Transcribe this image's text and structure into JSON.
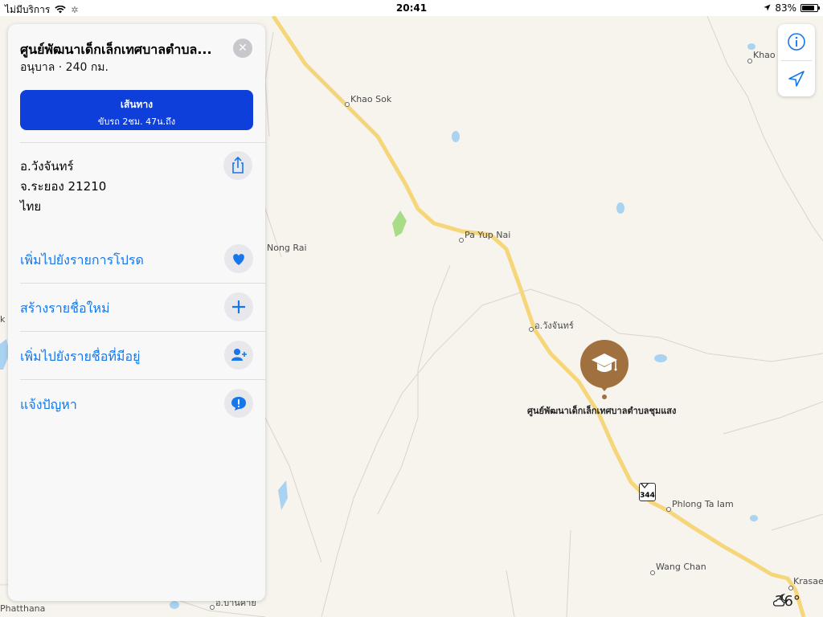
{
  "status_bar": {
    "carrier": "ไม่มีบริการ",
    "time": "20:41",
    "battery": "83%",
    "battery_level": 0.83,
    "wifi_icon": "wifi-icon",
    "activity_icon": "activity-spinner-icon",
    "location_icon": "location-arrow-icon"
  },
  "place_card": {
    "title": "ศูนย์พัฒนาเด็กเล็กเทศบาลตำบล...",
    "subtitle": "อนุบาล · 240 กม.",
    "close_icon": "close-icon",
    "directions": {
      "label": "เส้นทาง",
      "detail": "ขับรถ 2ชม. 47น.ถึง",
      "color": "#0f3fda"
    },
    "address": {
      "line1": "อ.วังจันทร์",
      "line2": "จ.ระยอง 21210",
      "line3": "ไทย"
    },
    "share_icon": "share-icon",
    "actions": [
      {
        "label": "เพิ่มไปยังรายการโปรด",
        "icon": "heart-icon"
      },
      {
        "label": "สร้างรายชื่อใหม่",
        "icon": "plus-icon"
      },
      {
        "label": "เพิ่มไปยังรายชื่อที่มีอยู่",
        "icon": "add-contact-icon"
      },
      {
        "label": "แจ้งปัญหา",
        "icon": "exclamation-bubble-icon"
      }
    ],
    "accent_color": "#1577e9"
  },
  "map": {
    "labels": [
      {
        "text": "Khao Sok",
        "id": "khao-sok"
      },
      {
        "text": "Pa Yup Nai",
        "id": "pa-yup-nai"
      },
      {
        "text": "Nong Rai",
        "id": "nong-rai"
      },
      {
        "text": "อ.วังจันทร์",
        "id": "wang-chan-district"
      },
      {
        "text": "Phlong Ta Iam",
        "id": "phlong-ta-iam"
      },
      {
        "text": "Wang Chan",
        "id": "wang-chan"
      },
      {
        "text": "Krasae",
        "id": "krasae"
      },
      {
        "text": "Khao I",
        "id": "khao-i"
      },
      {
        "text": "Phatthana",
        "id": "phatthana"
      },
      {
        "text": "อ.บ้านค่าย",
        "id": "ban-khai"
      },
      {
        "text": "k I",
        "id": "edge-label"
      }
    ],
    "pin_label": "ศูนย์พัฒนาเด็กเล็กเทศบาลตำบลชุมแสง",
    "pin_icon": "graduation-cap-icon",
    "pin_color": "#a0703f",
    "road_shield": "344",
    "road_color": "#f6d67a",
    "weather": {
      "temperature": "26°",
      "icon": "partly-cloudy-night-icon"
    }
  },
  "map_controls": {
    "info_icon": "info-icon",
    "location_icon": "navigation-arrow-icon"
  }
}
